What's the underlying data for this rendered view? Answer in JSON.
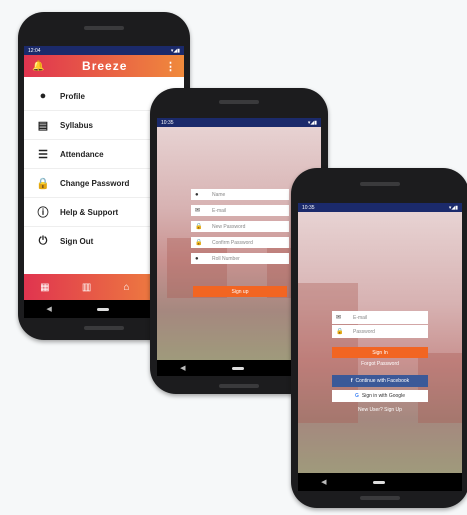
{
  "drawer_screen": {
    "status_time": "12:04",
    "app_title": "Breeze",
    "menu": [
      {
        "label": "Profile",
        "icon": "person-icon"
      },
      {
        "label": "Syllabus",
        "icon": "clipboard-icon"
      },
      {
        "label": "Attendance",
        "icon": "list-icon"
      },
      {
        "label": "Change Password",
        "icon": "lock-icon"
      },
      {
        "label": "Help & Support",
        "icon": "info-icon"
      },
      {
        "label": "Sign Out",
        "icon": "power-icon"
      }
    ],
    "bottom_nav": [
      "calendar-icon",
      "card-icon",
      "home-icon",
      "chat-icon"
    ]
  },
  "signup_screen": {
    "status_time": "10:35",
    "fields": [
      {
        "placeholder": "Name",
        "icon": "person-icon"
      },
      {
        "placeholder": "E-mail",
        "icon": "mail-icon"
      },
      {
        "placeholder": "New Password",
        "icon": "lock-icon"
      },
      {
        "placeholder": "Confirm Password",
        "icon": "lock-icon"
      },
      {
        "placeholder": "Roll Number",
        "icon": "person-icon"
      }
    ],
    "submit_label": "Sign up"
  },
  "login_screen": {
    "status_time": "10:35",
    "fields": [
      {
        "placeholder": "E-mail",
        "icon": "mail-icon"
      },
      {
        "placeholder": "Password",
        "icon": "lock-icon"
      }
    ],
    "submit_label": "Sign In",
    "forgot_label": "Forgot Password",
    "facebook_label": "Continue with Facebook",
    "google_label": "Sign in with Google",
    "new_user_label": "New User? Sign Up"
  }
}
